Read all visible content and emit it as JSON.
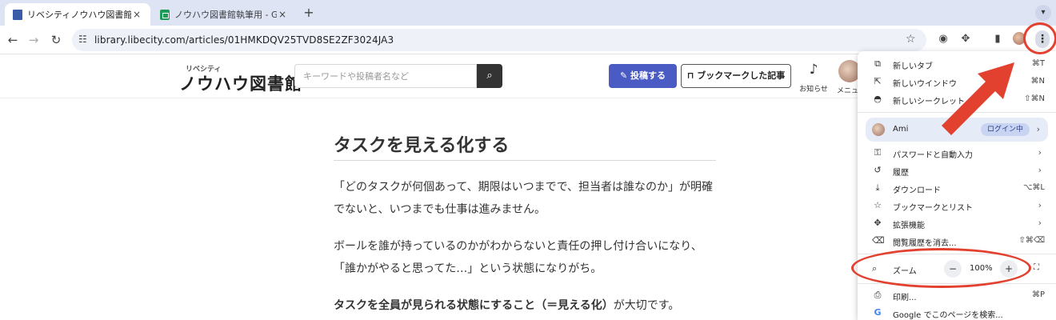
{
  "tabs": [
    {
      "title": "リベシティノウハウ図書館 | ノウ",
      "active": true
    },
    {
      "title": "ノウハウ図書館執筆用 - Google",
      "active": false
    }
  ],
  "tab_close_icon": "×",
  "new_tab_icon": "+",
  "toolbar": {
    "url": "library.libecity.com/articles/01HMKDQV25TVD8SE2ZF3024JA3"
  },
  "site": {
    "logo_small": "リベシティ",
    "logo_main": "ノウハウ図書館",
    "search_placeholder": "キーワードや投稿者名など",
    "post_button": "投稿する",
    "bookmark_button": "ブックマークした記事",
    "notifications_label": "お知らせ",
    "menu_label": "メニュ"
  },
  "article": {
    "title": "タスクを見える化する",
    "paragraphs": [
      "「どのタスクが何個あって、期限はいつまでで、担当者は誰なのか」が明確",
      "でないと、いつまでも仕事は進みません。",
      "ボールを誰が持っているのかがわからないと責任の押し付け合いになり、",
      "「誰かがやると思ってた…」という状態になりがち。",
      "タスクを全員が見られる状態にすること（＝見える化）",
      "が大切です。"
    ]
  },
  "menu": {
    "items_top": [
      {
        "label": "新しいタブ",
        "shortcut": "⌘T",
        "icon": "new-tab-icon"
      },
      {
        "label": "新しいウインドウ",
        "shortcut": "⌘N",
        "icon": "new-window-icon"
      },
      {
        "label": "新しいシークレット ウ",
        "shortcut": "⇧⌘N",
        "icon": "incognito-icon"
      }
    ],
    "profile": {
      "name": "Ami",
      "badge": "ログイン中"
    },
    "items_mid": [
      {
        "label": "パスワードと自動入力",
        "shortcut": "",
        "icon": "key-icon"
      },
      {
        "label": "履歴",
        "shortcut": "",
        "icon": "history-icon"
      },
      {
        "label": "ダウンロード",
        "shortcut": "⌥⌘L",
        "icon": "download-icon"
      },
      {
        "label": "ブックマークとリスト",
        "shortcut": "",
        "icon": "star-icon"
      },
      {
        "label": "拡張機能",
        "shortcut": "",
        "icon": "extensions-icon"
      },
      {
        "label": "閲覧履歴を消去...",
        "shortcut": "⇧⌘⌫",
        "icon": "trash-icon"
      }
    ],
    "zoom": {
      "label": "ズーム",
      "value": "100%",
      "minus": "−",
      "plus": "+"
    },
    "items_bottom": [
      {
        "label": "印刷...",
        "shortcut": "⌘P",
        "icon": "print-icon"
      },
      {
        "label": "Google でこのページを検索...",
        "shortcut": "",
        "icon": "google-icon"
      }
    ]
  },
  "annotation_color": "#e3412f"
}
